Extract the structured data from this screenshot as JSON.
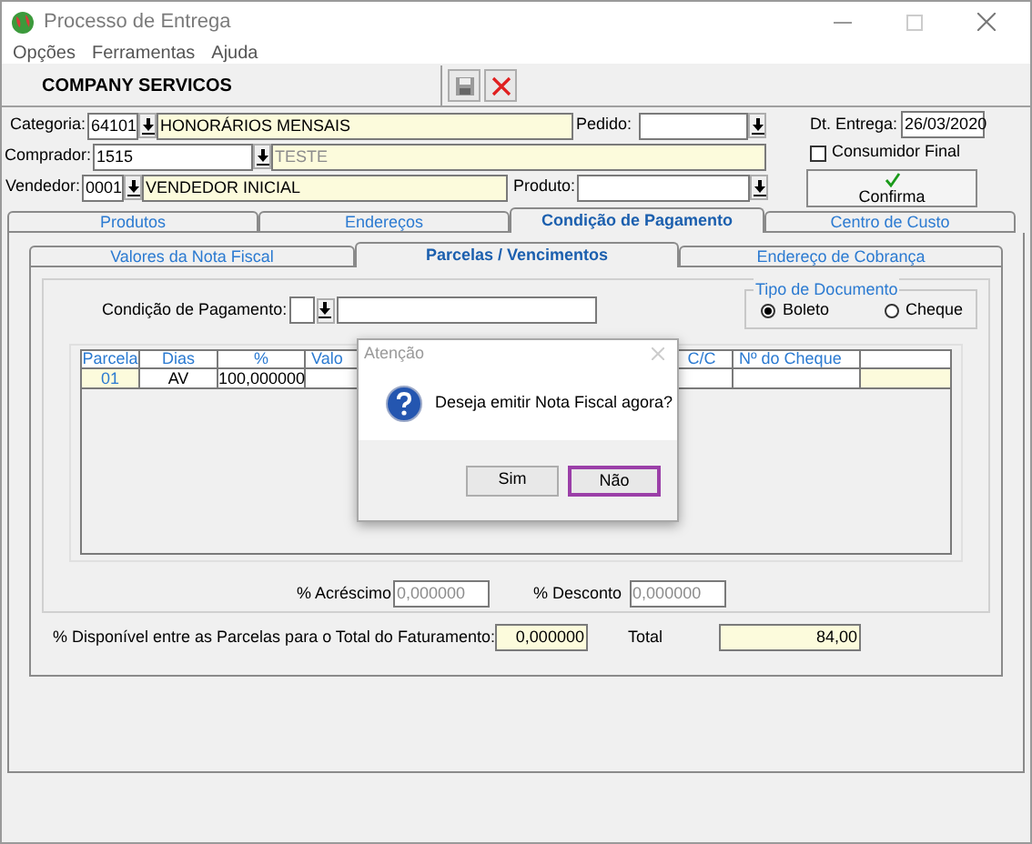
{
  "window": {
    "title": "Processo de Entrega"
  },
  "menu": [
    "Opções",
    "Ferramentas",
    "Ajuda"
  ],
  "toolbar": {
    "company": "COMPANY SERVICOS"
  },
  "form": {
    "categoria": {
      "label": "Categoria:",
      "code": "64101",
      "description": "HONORÁRIOS MENSAIS"
    },
    "pedido": {
      "label": "Pedido:"
    },
    "comprador": {
      "label": "Comprador:",
      "code": "1515",
      "description": "TESTE",
      "disabled": true
    },
    "vendedor": {
      "label": "Vendedor:",
      "code": "0001",
      "description": "VENDEDOR INICIAL"
    },
    "produto": {
      "label": "Produto:"
    },
    "dt_entrega": {
      "label": "Dt. Entrega:",
      "value": "26/03/2020"
    },
    "consumidor_final": {
      "label": "Consumidor Final",
      "checked": false
    },
    "confirm_button": "Confirma"
  },
  "tabs": [
    {
      "label": "Produtos",
      "selected": false
    },
    {
      "label": "Endereços",
      "selected": false
    },
    {
      "label": "Condição de Pagamento",
      "selected": true
    },
    {
      "label": "Centro de Custo",
      "selected": false
    }
  ],
  "subtabs": [
    {
      "label": "Valores da Nota Fiscal",
      "selected": false
    },
    {
      "label": "Parcelas / Vencimentos",
      "selected": true
    },
    {
      "label": "Endereço de Cobrança",
      "selected": false
    }
  ],
  "condicao": {
    "label": "Condição de Pagamento:"
  },
  "tipo_documento": {
    "title": "Tipo de Documento",
    "options": [
      {
        "label": "Boleto",
        "selected": true
      },
      {
        "label": "Cheque",
        "selected": false
      }
    ]
  },
  "grid": {
    "columns": [
      "Parcela",
      "Dias",
      "%",
      "Valo",
      "C/C",
      "Nº do Cheque"
    ],
    "rows": [
      {
        "cells": [
          "01",
          "AV",
          "100,000000"
        ]
      }
    ]
  },
  "acrescimo": {
    "label": "% Acréscimo",
    "value": "0,000000",
    "disabled": true
  },
  "desconto": {
    "label": "% Desconto",
    "value": "0,000000",
    "disabled": true
  },
  "disponivel": {
    "label": "% Disponível entre as Parcelas para o Total do Faturamento:",
    "value": "0,000000"
  },
  "total": {
    "label": "Total",
    "value": "84,00"
  },
  "dialog": {
    "title": "Atenção",
    "message": "Deseja emitir Nota Fiscal agora?",
    "buttons": [
      {
        "label": "Sim",
        "focused": false
      },
      {
        "label": "Não",
        "focused": true
      }
    ]
  }
}
